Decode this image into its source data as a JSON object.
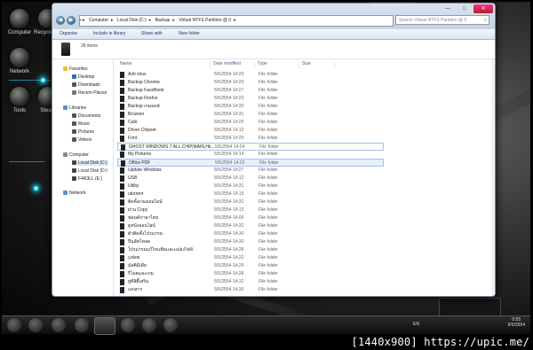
{
  "desktop": {
    "icons": [
      {
        "label": "Computer",
        "icon": "computer-icon"
      },
      {
        "label": "Recycle Bin",
        "icon": "recycle-bin-icon"
      },
      {
        "label": "Network",
        "icon": "network-icon"
      },
      {
        "label": "Tools",
        "icon": "tools-icon"
      },
      {
        "label": "Steam",
        "icon": "steam-icon"
      }
    ]
  },
  "window": {
    "breadcrumb": [
      "Computer",
      "Local Disk (C:)",
      "Backup",
      "Virtual NTFS Partition @ 0"
    ],
    "search_placeholder": "Search Virtual NTFS Partition @ 0",
    "toolbar": {
      "organize": "Organize",
      "include": "Include in library",
      "share": "Share with",
      "new_folder": "New folder"
    },
    "items_count": "28 items",
    "nav": {
      "favorites": "Favorites",
      "favorites_items": [
        "Desktop",
        "Downloads",
        "Recent Places"
      ],
      "libraries": "Libraries",
      "libraries_items": [
        "Documents",
        "Music",
        "Pictures",
        "Videos"
      ],
      "computer": "Computer",
      "computer_items": [
        "Local Disk (C:)",
        "Local Disk (D:)",
        "F4R3LL (E:)"
      ],
      "network": "Network"
    },
    "columns": {
      "name": "Name",
      "date": "Date modified",
      "type": "Type",
      "size": "Size"
    },
    "rows": [
      {
        "name": "Anti virus",
        "date": "5/5/2554 14:29",
        "type": "File folder"
      },
      {
        "name": "Backup Chrome",
        "date": "5/5/2554 14:29",
        "type": "File folder"
      },
      {
        "name": "Backup FaceBook",
        "date": "5/5/2554 14:27",
        "type": "File folder"
      },
      {
        "name": "Backup Firefox",
        "date": "5/5/2554 14:22",
        "type": "File folder"
      },
      {
        "name": "Backup เกมออฟ",
        "date": "5/5/2554 14:30",
        "type": "File folder"
      },
      {
        "name": "Browser",
        "date": "5/5/2554 14:31",
        "type": "File folder"
      },
      {
        "name": "Cafe",
        "date": "5/5/2554 14:25",
        "type": "File folder"
      },
      {
        "name": "Driver Chipset",
        "date": "5/5/2554 14:12",
        "type": "File folder"
      },
      {
        "name": "Font",
        "date": "5/5/2554 14:25",
        "type": "File folder"
      },
      {
        "name": "GHOST WINDOWS 7 ALL CHIP,MAIN,Hir...",
        "date": "5/5/2554 14:24",
        "type": "File folder"
      },
      {
        "name": "My Pictures",
        "date": "5/5/2554 14:14",
        "type": "File folder"
      },
      {
        "name": "Office PDF",
        "date": "5/5/2554 14:23",
        "type": "File folder"
      },
      {
        "name": "Update Windows",
        "date": "5/5/2554 14:27",
        "type": "File folder"
      },
      {
        "name": "USB",
        "date": "5/5/2554 14:12",
        "type": "File folder"
      },
      {
        "name": "Utility",
        "date": "5/5/2554 14:31",
        "type": "File folder"
      },
      {
        "name": "utorrent",
        "date": "5/5/2554 14:15",
        "type": "File folder"
      },
      {
        "name": "ติดตั้งเกมออนไลน์",
        "date": "5/5/2554 14:32",
        "type": "File folder"
      },
      {
        "name": "ผ่าน Copy",
        "date": "5/5/2554 14:13",
        "type": "File folder"
      },
      {
        "name": "ฟอนต์ภาษาไทย",
        "date": "5/5/2554 14:09",
        "type": "File folder"
      },
      {
        "name": "ดูหนังออนไลน์",
        "date": "5/5/2554 14:32",
        "type": "File folder"
      },
      {
        "name": "ตัวติดตั้งโปรแกรม",
        "date": "5/5/2554 14:30",
        "type": "File folder"
      },
      {
        "name": "ปีนอัพโหลด",
        "date": "5/5/2554 14:30",
        "type": "File folder"
      },
      {
        "name": "โปรแกรมแก้ไขแฟ้มและแปลงไฟล์",
        "date": "5/5/2554 14:28",
        "type": "File folder"
      },
      {
        "name": "แฟลช",
        "date": "5/5/2554 14:22",
        "type": "File folder"
      },
      {
        "name": "มัลติมีเดีย",
        "date": "5/5/2554 14:25",
        "type": "File folder"
      },
      {
        "name": "รีโมตและเกม",
        "date": "5/5/2554 14:28",
        "type": "File folder"
      },
      {
        "name": "ยูทิลิตี้เสริม",
        "date": "5/5/2554 14:32",
        "type": "File folder"
      },
      {
        "name": "เอกสาร",
        "date": "5/5/2554 14:30",
        "type": "File folder"
      }
    ],
    "selected_index": 11,
    "hover_index": 9
  },
  "taskbar": {
    "lang": "EN",
    "time": "0:55",
    "date": "9/5/2554"
  },
  "watermark": "[1440x900] https://upic.me/",
  "colors": {
    "accent": "#2ccfff",
    "selection": "#e6f0fb"
  }
}
